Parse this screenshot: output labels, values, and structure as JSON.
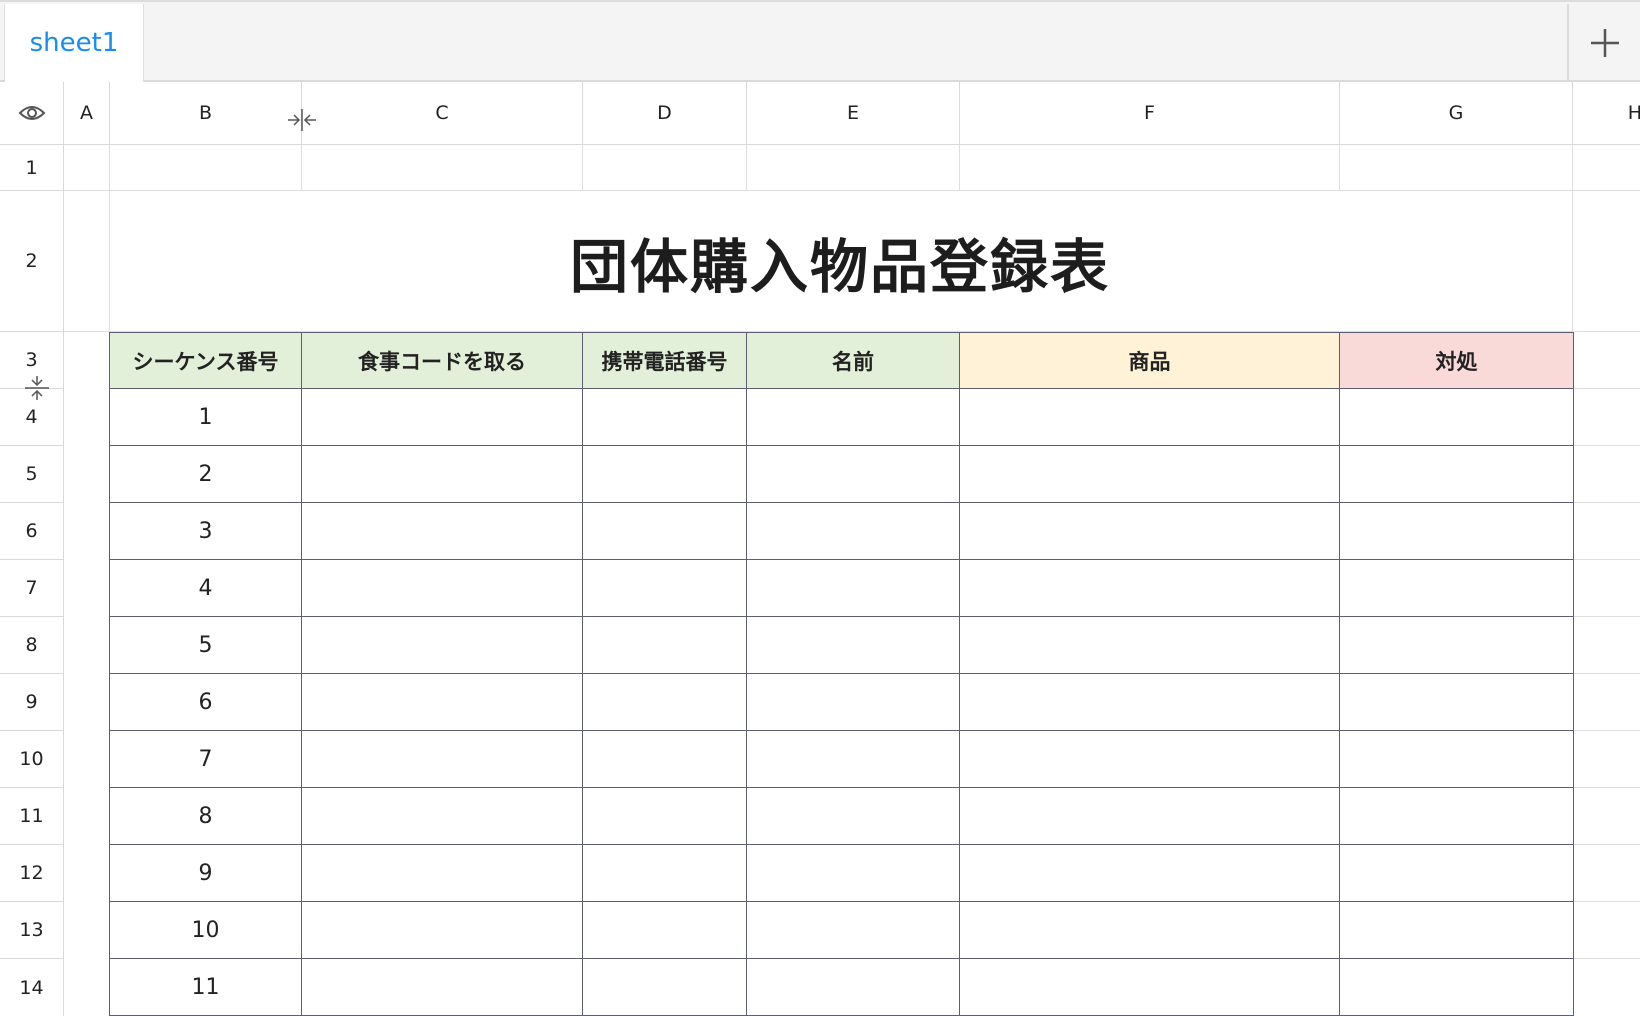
{
  "tabs": {
    "active_label": "sheet1",
    "add_icon": "plus-icon"
  },
  "column_headers": [
    "A",
    "B",
    "C",
    "D",
    "E",
    "F",
    "G",
    "H"
  ],
  "row_headers": [
    "1",
    "2",
    "3",
    "4",
    "5",
    "6",
    "7",
    "8",
    "9",
    "10",
    "11",
    "12",
    "13",
    "14"
  ],
  "sheet": {
    "title": "団体購入物品登録表",
    "table_headers": [
      {
        "label": "シーケンス番号",
        "color": "#e2efd9"
      },
      {
        "label": "食事コードを取る",
        "color": "#e2efd9"
      },
      {
        "label": "携帯電話番号",
        "color": "#e2efd9"
      },
      {
        "label": "名前",
        "color": "#e2efd9"
      },
      {
        "label": "商品",
        "color": "#fff2d6"
      },
      {
        "label": "対処",
        "color": "#fad9d9"
      }
    ],
    "rows": [
      [
        "1",
        "",
        "",
        "",
        "",
        ""
      ],
      [
        "2",
        "",
        "",
        "",
        "",
        ""
      ],
      [
        "3",
        "",
        "",
        "",
        "",
        ""
      ],
      [
        "4",
        "",
        "",
        "",
        "",
        ""
      ],
      [
        "5",
        "",
        "",
        "",
        "",
        ""
      ],
      [
        "6",
        "",
        "",
        "",
        "",
        ""
      ],
      [
        "7",
        "",
        "",
        "",
        "",
        ""
      ],
      [
        "8",
        "",
        "",
        "",
        "",
        ""
      ],
      [
        "9",
        "",
        "",
        "",
        "",
        ""
      ],
      [
        "10",
        "",
        "",
        "",
        "",
        ""
      ],
      [
        "11",
        "",
        "",
        "",
        "",
        ""
      ]
    ]
  },
  "icons": {
    "visibility": "eye-icon",
    "column_resize": "column-resize-icon",
    "row_resize": "row-resize-icon"
  }
}
